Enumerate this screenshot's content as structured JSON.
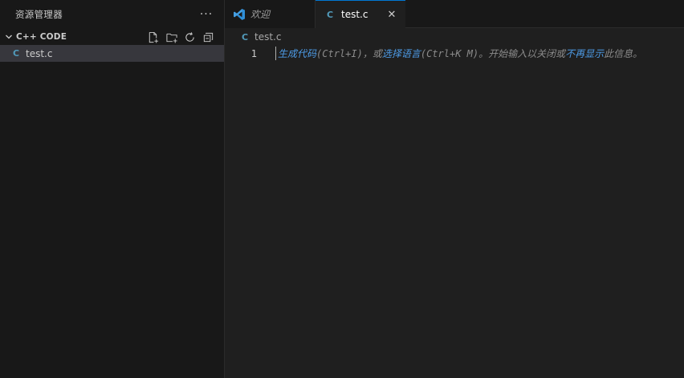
{
  "explorer": {
    "title": "资源管理器",
    "more_label": "···",
    "section": {
      "label": "C++ CODE",
      "actions": [
        "new-file-icon",
        "new-folder-icon",
        "refresh-icon",
        "collapse-all-icon"
      ]
    },
    "files": [
      {
        "icon_letter": "C",
        "name": "test.c"
      }
    ]
  },
  "tabs": [
    {
      "label": "欢迎",
      "icon": "vscode-icon",
      "active": false
    },
    {
      "label": "test.c",
      "icon_letter": "C",
      "active": true,
      "close_label": "✕"
    }
  ],
  "breadcrumb": {
    "icon_letter": "C",
    "file": "test.c"
  },
  "editor": {
    "line_number": "1",
    "hint": {
      "link1": "生成代码",
      "text1": "(Ctrl+I)，或",
      "link2": "选择语言",
      "text2": "(Ctrl+K M)。开始输入以关闭或",
      "link3": "不再显示",
      "text3": "此信息。"
    }
  },
  "colors": {
    "accent": "#0078d4",
    "c_file": "#519aba",
    "link": "#4d9be6",
    "sidebar_bg": "#181818",
    "editor_bg": "#1f1f1f"
  }
}
